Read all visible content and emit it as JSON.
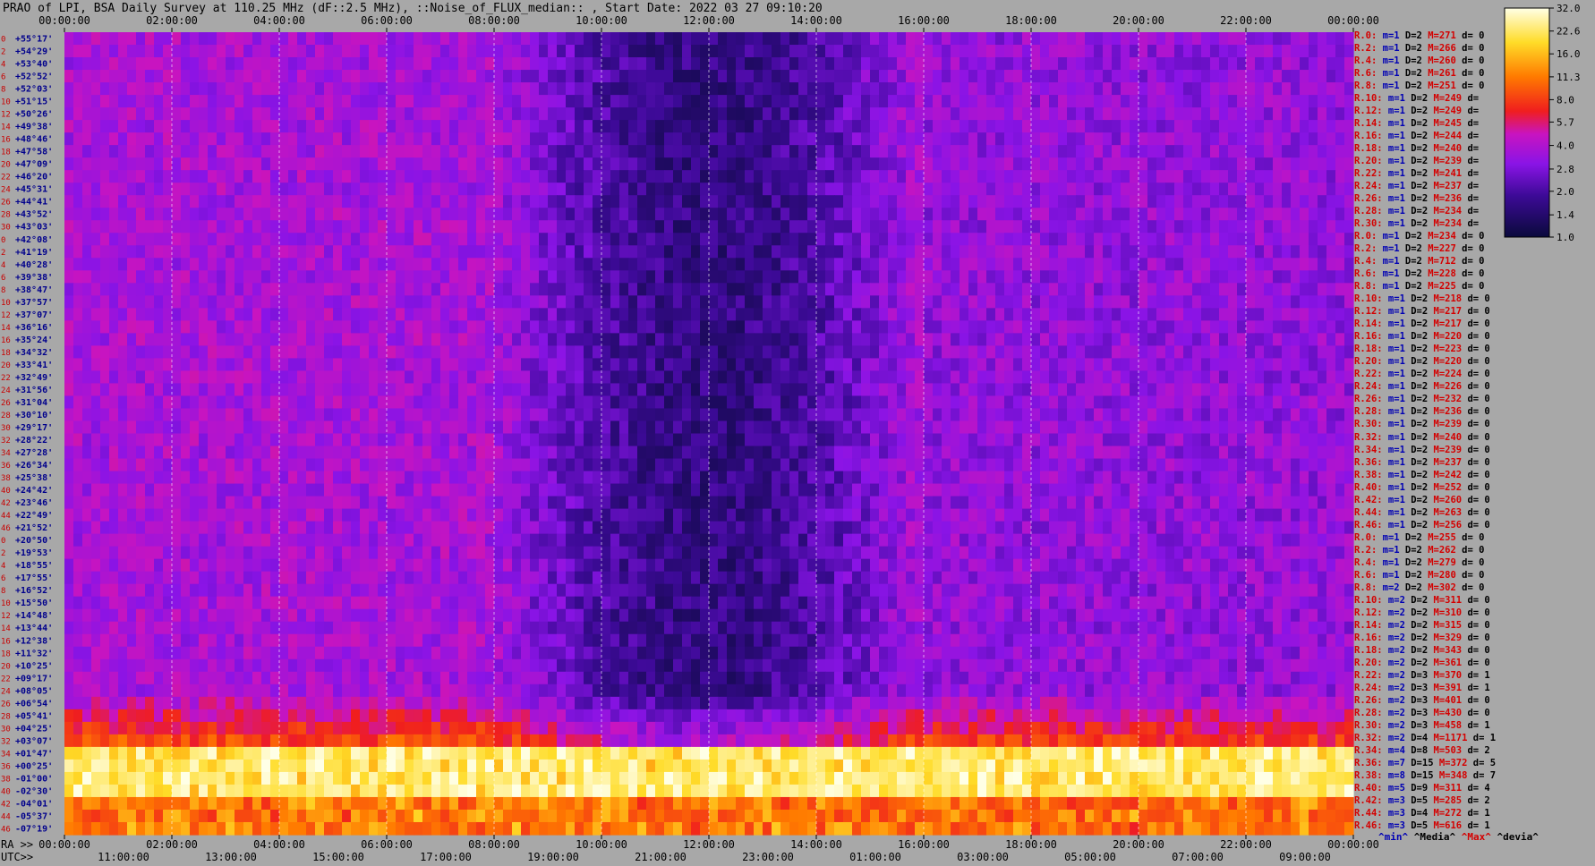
{
  "title": "PRAO of LPI, BSA Daily Survey at 110.25 MHz (dF::2.5 MHz), ::Noise_of_FLUX_median:: , Start Date: 2022 03 27 09:10:20",
  "chart_data": {
    "type": "heatmap",
    "top_axis": {
      "ticks": [
        "00:00:00",
        "02:00:00",
        "04:00:00",
        "06:00:00",
        "08:00:00",
        "10:00:00",
        "12:00:00",
        "14:00:00",
        "16:00:00",
        "18:00:00",
        "20:00:00",
        "22:00:00",
        "00:00:00"
      ]
    },
    "bottom_axis_ra": {
      "prefix": "RA >>",
      "ticks": [
        "00:00:00",
        "02:00:00",
        "04:00:00",
        "06:00:00",
        "08:00:00",
        "10:00:00",
        "12:00:00",
        "14:00:00",
        "16:00:00",
        "18:00:00",
        "20:00:00",
        "22:00:00",
        "00:00:00"
      ]
    },
    "bottom_axis_utc": {
      "prefix": "UTC>>",
      "ticks": [
        "11:00:00",
        "13:00:00",
        "15:00:00",
        "17:00:00",
        "19:00:00",
        "21:00:00",
        "23:00:00",
        "01:00:00",
        "03:00:00",
        "05:00:00",
        "07:00:00",
        "09:00:00"
      ]
    },
    "declinations": [
      "+55°17'",
      "+54°29'",
      "+53°40'",
      "+52°52'",
      "+52°03'",
      "+51°15'",
      "+50°26'",
      "+49°38'",
      "+48°46'",
      "+47°58'",
      "+47°09'",
      "+46°20'",
      "+45°31'",
      "+44°41'",
      "+43°52'",
      "+43°03'",
      "+42°08'",
      "+41°19'",
      "+40°28'",
      "+39°38'",
      "+38°47'",
      "+37°57'",
      "+37°07'",
      "+36°16'",
      "+35°24'",
      "+34°32'",
      "+33°41'",
      "+32°49'",
      "+31°56'",
      "+31°04'",
      "+30°10'",
      "+29°17'",
      "+28°22'",
      "+27°28'",
      "+26°34'",
      "+25°38'",
      "+24°42'",
      "+23°46'",
      "+22°49'",
      "+21°52'",
      "+20°50'",
      "+19°53'",
      "+18°55'",
      "+17°55'",
      "+16°52'",
      "+15°50'",
      "+14°48'",
      "+13°44'",
      "+12°38'",
      "+11°32'",
      "+10°25'",
      "+09°17'",
      "+08°05'",
      "+06°54'",
      "+05°41'",
      "+04°25'",
      "+03°07'",
      "+01°47'",
      "+00°25'",
      "-01°00'",
      "-02°30'",
      "-04°01'",
      "-05°37'",
      "-07°19'"
    ],
    "beam_numbers": [
      0,
      2,
      4,
      6,
      8,
      10,
      12,
      14,
      16,
      18,
      20,
      22,
      24,
      26,
      28,
      30,
      0,
      2,
      4,
      6,
      8,
      10,
      12,
      14,
      16,
      18,
      20,
      22,
      24,
      26,
      28,
      30,
      32,
      34,
      36,
      38,
      40,
      42,
      44,
      46,
      0,
      2,
      4,
      6,
      8,
      10,
      12,
      14,
      16,
      18,
      20,
      22,
      24,
      26,
      28,
      30,
      32,
      34,
      36,
      38,
      40,
      42,
      44,
      46
    ],
    "colorbar": {
      "ticks": [
        "32.0",
        "22.6",
        "16.0",
        "11.3",
        "8.0",
        "5.7",
        "4.0",
        "2.8",
        "2.0",
        "1.4",
        "1.0"
      ],
      "scale": "log",
      "range": [
        1.0,
        32.0
      ]
    },
    "legend": {
      "min": "^min^",
      "median": "^Media^",
      "max": "^Max^",
      "dev": "^devia^"
    },
    "beam_stats": [
      {
        "beam": "R.0:",
        "min": "m=1",
        "d": "D=2",
        "max": "M=271",
        "dev": "d= 0"
      },
      {
        "beam": "R.2:",
        "min": "m=1",
        "d": "D=2",
        "max": "M=266",
        "dev": "d= 0"
      },
      {
        "beam": "R.4:",
        "min": "m=1",
        "d": "D=2",
        "max": "M=260",
        "dev": "d= 0"
      },
      {
        "beam": "R.6:",
        "min": "m=1",
        "d": "D=2",
        "max": "M=261",
        "dev": "d= 0"
      },
      {
        "beam": "R.8:",
        "min": "m=1",
        "d": "D=2",
        "max": "M=251",
        "dev": "d= 0"
      },
      {
        "beam": "R.10:",
        "min": "m=1",
        "d": "D=2",
        "max": "M=249",
        "dev": "d="
      },
      {
        "beam": "R.12:",
        "min": "m=1",
        "d": "D=2",
        "max": "M=249",
        "dev": "d="
      },
      {
        "beam": "R.14:",
        "min": "m=1",
        "d": "D=2",
        "max": "M=245",
        "dev": "d="
      },
      {
        "beam": "R.16:",
        "min": "m=1",
        "d": "D=2",
        "max": "M=244",
        "dev": "d="
      },
      {
        "beam": "R.18:",
        "min": "m=1",
        "d": "D=2",
        "max": "M=240",
        "dev": "d="
      },
      {
        "beam": "R.20:",
        "min": "m=1",
        "d": "D=2",
        "max": "M=239",
        "dev": "d="
      },
      {
        "beam": "R.22:",
        "min": "m=1",
        "d": "D=2",
        "max": "M=241",
        "dev": "d="
      },
      {
        "beam": "R.24:",
        "min": "m=1",
        "d": "D=2",
        "max": "M=237",
        "dev": "d="
      },
      {
        "beam": "R.26:",
        "min": "m=1",
        "d": "D=2",
        "max": "M=236",
        "dev": "d="
      },
      {
        "beam": "R.28:",
        "min": "m=1",
        "d": "D=2",
        "max": "M=234",
        "dev": "d="
      },
      {
        "beam": "R.30:",
        "min": "m=1",
        "d": "D=2",
        "max": "M=234",
        "dev": "d="
      },
      {
        "beam": "R.0:",
        "min": "m=1",
        "d": "D=2",
        "max": "M=234",
        "dev": "d= 0"
      },
      {
        "beam": "R.2:",
        "min": "m=1",
        "d": "D=2",
        "max": "M=227",
        "dev": "d= 0"
      },
      {
        "beam": "R.4:",
        "min": "m=1",
        "d": "D=2",
        "max": "M=712",
        "dev": "d= 0"
      },
      {
        "beam": "R.6:",
        "min": "m=1",
        "d": "D=2",
        "max": "M=228",
        "dev": "d= 0"
      },
      {
        "beam": "R.8:",
        "min": "m=1",
        "d": "D=2",
        "max": "M=225",
        "dev": "d= 0"
      },
      {
        "beam": "R.10:",
        "min": "m=1",
        "d": "D=2",
        "max": "M=218",
        "dev": "d= 0"
      },
      {
        "beam": "R.12:",
        "min": "m=1",
        "d": "D=2",
        "max": "M=217",
        "dev": "d= 0"
      },
      {
        "beam": "R.14:",
        "min": "m=1",
        "d": "D=2",
        "max": "M=217",
        "dev": "d= 0"
      },
      {
        "beam": "R.16:",
        "min": "m=1",
        "d": "D=2",
        "max": "M=220",
        "dev": "d= 0"
      },
      {
        "beam": "R.18:",
        "min": "m=1",
        "d": "D=2",
        "max": "M=223",
        "dev": "d= 0"
      },
      {
        "beam": "R.20:",
        "min": "m=1",
        "d": "D=2",
        "max": "M=220",
        "dev": "d= 0"
      },
      {
        "beam": "R.22:",
        "min": "m=1",
        "d": "D=2",
        "max": "M=224",
        "dev": "d= 0"
      },
      {
        "beam": "R.24:",
        "min": "m=1",
        "d": "D=2",
        "max": "M=226",
        "dev": "d= 0"
      },
      {
        "beam": "R.26:",
        "min": "m=1",
        "d": "D=2",
        "max": "M=232",
        "dev": "d= 0"
      },
      {
        "beam": "R.28:",
        "min": "m=1",
        "d": "D=2",
        "max": "M=236",
        "dev": "d= 0"
      },
      {
        "beam": "R.30:",
        "min": "m=1",
        "d": "D=2",
        "max": "M=239",
        "dev": "d= 0"
      },
      {
        "beam": "R.32:",
        "min": "m=1",
        "d": "D=2",
        "max": "M=240",
        "dev": "d= 0"
      },
      {
        "beam": "R.34:",
        "min": "m=1",
        "d": "D=2",
        "max": "M=239",
        "dev": "d= 0"
      },
      {
        "beam": "R.36:",
        "min": "m=1",
        "d": "D=2",
        "max": "M=237",
        "dev": "d= 0"
      },
      {
        "beam": "R.38:",
        "min": "m=1",
        "d": "D=2",
        "max": "M=242",
        "dev": "d= 0"
      },
      {
        "beam": "R.40:",
        "min": "m=1",
        "d": "D=2",
        "max": "M=252",
        "dev": "d= 0"
      },
      {
        "beam": "R.42:",
        "min": "m=1",
        "d": "D=2",
        "max": "M=260",
        "dev": "d= 0"
      },
      {
        "beam": "R.44:",
        "min": "m=1",
        "d": "D=2",
        "max": "M=263",
        "dev": "d= 0"
      },
      {
        "beam": "R.46:",
        "min": "m=1",
        "d": "D=2",
        "max": "M=256",
        "dev": "d= 0"
      },
      {
        "beam": "R.0:",
        "min": "m=1",
        "d": "D=2",
        "max": "M=255",
        "dev": "d= 0"
      },
      {
        "beam": "R.2:",
        "min": "m=1",
        "d": "D=2",
        "max": "M=262",
        "dev": "d= 0"
      },
      {
        "beam": "R.4:",
        "min": "m=1",
        "d": "D=2",
        "max": "M=279",
        "dev": "d= 0"
      },
      {
        "beam": "R.6:",
        "min": "m=1",
        "d": "D=2",
        "max": "M=280",
        "dev": "d= 0"
      },
      {
        "beam": "R.8:",
        "min": "m=2",
        "d": "D=2",
        "max": "M=302",
        "dev": "d= 0"
      },
      {
        "beam": "R.10:",
        "min": "m=2",
        "d": "D=2",
        "max": "M=311",
        "dev": "d= 0"
      },
      {
        "beam": "R.12:",
        "min": "m=2",
        "d": "D=2",
        "max": "M=310",
        "dev": "d= 0"
      },
      {
        "beam": "R.14:",
        "min": "m=2",
        "d": "D=2",
        "max": "M=315",
        "dev": "d= 0"
      },
      {
        "beam": "R.16:",
        "min": "m=2",
        "d": "D=2",
        "max": "M=329",
        "dev": "d= 0"
      },
      {
        "beam": "R.18:",
        "min": "m=2",
        "d": "D=2",
        "max": "M=343",
        "dev": "d= 0"
      },
      {
        "beam": "R.20:",
        "min": "m=2",
        "d": "D=2",
        "max": "M=361",
        "dev": "d= 0"
      },
      {
        "beam": "R.22:",
        "min": "m=2",
        "d": "D=3",
        "max": "M=370",
        "dev": "d= 1"
      },
      {
        "beam": "R.24:",
        "min": "m=2",
        "d": "D=3",
        "max": "M=391",
        "dev": "d= 1"
      },
      {
        "beam": "R.26:",
        "min": "m=2",
        "d": "D=3",
        "max": "M=401",
        "dev": "d= 0"
      },
      {
        "beam": "R.28:",
        "min": "m=2",
        "d": "D=3",
        "max": "M=430",
        "dev": "d= 0"
      },
      {
        "beam": "R.30:",
        "min": "m=2",
        "d": "D=3",
        "max": "M=458",
        "dev": "d= 1"
      },
      {
        "beam": "R.32:",
        "min": "m=2",
        "d": "D=4",
        "max": "M=1171",
        "dev": "d= 1"
      },
      {
        "beam": "R.34:",
        "min": "m=4",
        "d": "D=8",
        "max": "M=503",
        "dev": "d= 2"
      },
      {
        "beam": "R.36:",
        "min": "m=7",
        "d": "D=15",
        "max": "M=372",
        "dev": "d= 5"
      },
      {
        "beam": "R.38:",
        "min": "m=8",
        "d": "D=15",
        "max": "M=348",
        "dev": "d= 7"
      },
      {
        "beam": "R.40:",
        "min": "m=5",
        "d": "D=9",
        "max": "M=311",
        "dev": "d= 4"
      },
      {
        "beam": "R.42:",
        "min": "m=3",
        "d": "D=5",
        "max": "M=285",
        "dev": "d= 2"
      },
      {
        "beam": "R.44:",
        "min": "m=3",
        "d": "D=4",
        "max": "M=272",
        "dev": "d= 1"
      },
      {
        "beam": "R.46:",
        "min": "m=3",
        "d": "D=5",
        "max": "M=616",
        "dev": "d= 1"
      }
    ]
  }
}
